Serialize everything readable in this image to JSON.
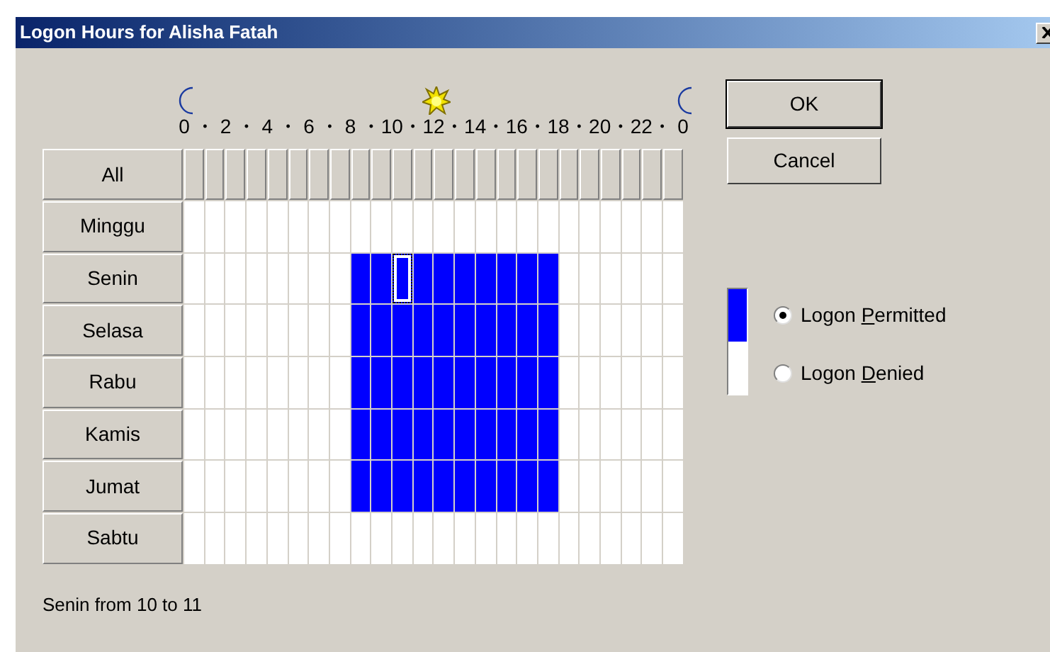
{
  "window": {
    "title": "Logon Hours for Alisha Fatah"
  },
  "hour_scale": {
    "labels": [
      "0",
      "2",
      "4",
      "6",
      "8",
      "10",
      "12",
      "14",
      "16",
      "18",
      "20",
      "22",
      "0"
    ],
    "separator": "•"
  },
  "all_button": {
    "label": "All"
  },
  "days": [
    {
      "label": "Minggu",
      "cells": [
        {
          "permitted": false,
          "focused": false
        },
        {
          "permitted": false,
          "focused": false
        },
        {
          "permitted": false,
          "focused": false
        },
        {
          "permitted": false,
          "focused": false
        },
        {
          "permitted": false,
          "focused": false
        },
        {
          "permitted": false,
          "focused": false
        },
        {
          "permitted": false,
          "focused": false
        },
        {
          "permitted": false,
          "focused": false
        },
        {
          "permitted": false,
          "focused": false
        },
        {
          "permitted": false,
          "focused": false
        },
        {
          "permitted": false,
          "focused": false
        },
        {
          "permitted": false,
          "focused": false
        },
        {
          "permitted": false,
          "focused": false
        },
        {
          "permitted": false,
          "focused": false
        },
        {
          "permitted": false,
          "focused": false
        },
        {
          "permitted": false,
          "focused": false
        },
        {
          "permitted": false,
          "focused": false
        },
        {
          "permitted": false,
          "focused": false
        },
        {
          "permitted": false,
          "focused": false
        },
        {
          "permitted": false,
          "focused": false
        },
        {
          "permitted": false,
          "focused": false
        },
        {
          "permitted": false,
          "focused": false
        },
        {
          "permitted": false,
          "focused": false
        },
        {
          "permitted": false,
          "focused": false
        }
      ]
    },
    {
      "label": "Senin",
      "cells": [
        {
          "permitted": false,
          "focused": false
        },
        {
          "permitted": false,
          "focused": false
        },
        {
          "permitted": false,
          "focused": false
        },
        {
          "permitted": false,
          "focused": false
        },
        {
          "permitted": false,
          "focused": false
        },
        {
          "permitted": false,
          "focused": false
        },
        {
          "permitted": false,
          "focused": false
        },
        {
          "permitted": false,
          "focused": false
        },
        {
          "permitted": true,
          "focused": false
        },
        {
          "permitted": true,
          "focused": false
        },
        {
          "permitted": true,
          "focused": true
        },
        {
          "permitted": true,
          "focused": false
        },
        {
          "permitted": true,
          "focused": false
        },
        {
          "permitted": true,
          "focused": false
        },
        {
          "permitted": true,
          "focused": false
        },
        {
          "permitted": true,
          "focused": false
        },
        {
          "permitted": true,
          "focused": false
        },
        {
          "permitted": true,
          "focused": false
        },
        {
          "permitted": false,
          "focused": false
        },
        {
          "permitted": false,
          "focused": false
        },
        {
          "permitted": false,
          "focused": false
        },
        {
          "permitted": false,
          "focused": false
        },
        {
          "permitted": false,
          "focused": false
        },
        {
          "permitted": false,
          "focused": false
        }
      ]
    },
    {
      "label": "Selasa",
      "cells": [
        {
          "permitted": false,
          "focused": false
        },
        {
          "permitted": false,
          "focused": false
        },
        {
          "permitted": false,
          "focused": false
        },
        {
          "permitted": false,
          "focused": false
        },
        {
          "permitted": false,
          "focused": false
        },
        {
          "permitted": false,
          "focused": false
        },
        {
          "permitted": false,
          "focused": false
        },
        {
          "permitted": false,
          "focused": false
        },
        {
          "permitted": true,
          "focused": false
        },
        {
          "permitted": true,
          "focused": false
        },
        {
          "permitted": true,
          "focused": false
        },
        {
          "permitted": true,
          "focused": false
        },
        {
          "permitted": true,
          "focused": false
        },
        {
          "permitted": true,
          "focused": false
        },
        {
          "permitted": true,
          "focused": false
        },
        {
          "permitted": true,
          "focused": false
        },
        {
          "permitted": true,
          "focused": false
        },
        {
          "permitted": true,
          "focused": false
        },
        {
          "permitted": false,
          "focused": false
        },
        {
          "permitted": false,
          "focused": false
        },
        {
          "permitted": false,
          "focused": false
        },
        {
          "permitted": false,
          "focused": false
        },
        {
          "permitted": false,
          "focused": false
        },
        {
          "permitted": false,
          "focused": false
        }
      ]
    },
    {
      "label": "Rabu",
      "cells": [
        {
          "permitted": false,
          "focused": false
        },
        {
          "permitted": false,
          "focused": false
        },
        {
          "permitted": false,
          "focused": false
        },
        {
          "permitted": false,
          "focused": false
        },
        {
          "permitted": false,
          "focused": false
        },
        {
          "permitted": false,
          "focused": false
        },
        {
          "permitted": false,
          "focused": false
        },
        {
          "permitted": false,
          "focused": false
        },
        {
          "permitted": true,
          "focused": false
        },
        {
          "permitted": true,
          "focused": false
        },
        {
          "permitted": true,
          "focused": false
        },
        {
          "permitted": true,
          "focused": false
        },
        {
          "permitted": true,
          "focused": false
        },
        {
          "permitted": true,
          "focused": false
        },
        {
          "permitted": true,
          "focused": false
        },
        {
          "permitted": true,
          "focused": false
        },
        {
          "permitted": true,
          "focused": false
        },
        {
          "permitted": true,
          "focused": false
        },
        {
          "permitted": false,
          "focused": false
        },
        {
          "permitted": false,
          "focused": false
        },
        {
          "permitted": false,
          "focused": false
        },
        {
          "permitted": false,
          "focused": false
        },
        {
          "permitted": false,
          "focused": false
        },
        {
          "permitted": false,
          "focused": false
        }
      ]
    },
    {
      "label": "Kamis",
      "cells": [
        {
          "permitted": false,
          "focused": false
        },
        {
          "permitted": false,
          "focused": false
        },
        {
          "permitted": false,
          "focused": false
        },
        {
          "permitted": false,
          "focused": false
        },
        {
          "permitted": false,
          "focused": false
        },
        {
          "permitted": false,
          "focused": false
        },
        {
          "permitted": false,
          "focused": false
        },
        {
          "permitted": false,
          "focused": false
        },
        {
          "permitted": true,
          "focused": false
        },
        {
          "permitted": true,
          "focused": false
        },
        {
          "permitted": true,
          "focused": false
        },
        {
          "permitted": true,
          "focused": false
        },
        {
          "permitted": true,
          "focused": false
        },
        {
          "permitted": true,
          "focused": false
        },
        {
          "permitted": true,
          "focused": false
        },
        {
          "permitted": true,
          "focused": false
        },
        {
          "permitted": true,
          "focused": false
        },
        {
          "permitted": true,
          "focused": false
        },
        {
          "permitted": false,
          "focused": false
        },
        {
          "permitted": false,
          "focused": false
        },
        {
          "permitted": false,
          "focused": false
        },
        {
          "permitted": false,
          "focused": false
        },
        {
          "permitted": false,
          "focused": false
        },
        {
          "permitted": false,
          "focused": false
        }
      ]
    },
    {
      "label": "Jumat",
      "cells": [
        {
          "permitted": false,
          "focused": false
        },
        {
          "permitted": false,
          "focused": false
        },
        {
          "permitted": false,
          "focused": false
        },
        {
          "permitted": false,
          "focused": false
        },
        {
          "permitted": false,
          "focused": false
        },
        {
          "permitted": false,
          "focused": false
        },
        {
          "permitted": false,
          "focused": false
        },
        {
          "permitted": false,
          "focused": false
        },
        {
          "permitted": true,
          "focused": false
        },
        {
          "permitted": true,
          "focused": false
        },
        {
          "permitted": true,
          "focused": false
        },
        {
          "permitted": true,
          "focused": false
        },
        {
          "permitted": true,
          "focused": false
        },
        {
          "permitted": true,
          "focused": false
        },
        {
          "permitted": true,
          "focused": false
        },
        {
          "permitted": true,
          "focused": false
        },
        {
          "permitted": true,
          "focused": false
        },
        {
          "permitted": true,
          "focused": false
        },
        {
          "permitted": false,
          "focused": false
        },
        {
          "permitted": false,
          "focused": false
        },
        {
          "permitted": false,
          "focused": false
        },
        {
          "permitted": false,
          "focused": false
        },
        {
          "permitted": false,
          "focused": false
        },
        {
          "permitted": false,
          "focused": false
        }
      ]
    },
    {
      "label": "Sabtu",
      "cells": [
        {
          "permitted": false,
          "focused": false
        },
        {
          "permitted": false,
          "focused": false
        },
        {
          "permitted": false,
          "focused": false
        },
        {
          "permitted": false,
          "focused": false
        },
        {
          "permitted": false,
          "focused": false
        },
        {
          "permitted": false,
          "focused": false
        },
        {
          "permitted": false,
          "focused": false
        },
        {
          "permitted": false,
          "focused": false
        },
        {
          "permitted": false,
          "focused": false
        },
        {
          "permitted": false,
          "focused": false
        },
        {
          "permitted": false,
          "focused": false
        },
        {
          "permitted": false,
          "focused": false
        },
        {
          "permitted": false,
          "focused": false
        },
        {
          "permitted": false,
          "focused": false
        },
        {
          "permitted": false,
          "focused": false
        },
        {
          "permitted": false,
          "focused": false
        },
        {
          "permitted": false,
          "focused": false
        },
        {
          "permitted": false,
          "focused": false
        },
        {
          "permitted": false,
          "focused": false
        },
        {
          "permitted": false,
          "focused": false
        },
        {
          "permitted": false,
          "focused": false
        },
        {
          "permitted": false,
          "focused": false
        },
        {
          "permitted": false,
          "focused": false
        },
        {
          "permitted": false,
          "focused": false
        }
      ]
    }
  ],
  "buttons": [
    {
      "label": "OK",
      "kind": "default"
    },
    {
      "label": "Cancel",
      "kind": "normal"
    }
  ],
  "legend": [
    {
      "kind": "permitted",
      "label_parts": [
        "Logon ",
        "P",
        "ermitted"
      ],
      "selected": true
    },
    {
      "kind": "denied",
      "label_parts": [
        "Logon ",
        "D",
        "enied"
      ],
      "selected": false
    }
  ],
  "status": "Senin from 10 to 11"
}
